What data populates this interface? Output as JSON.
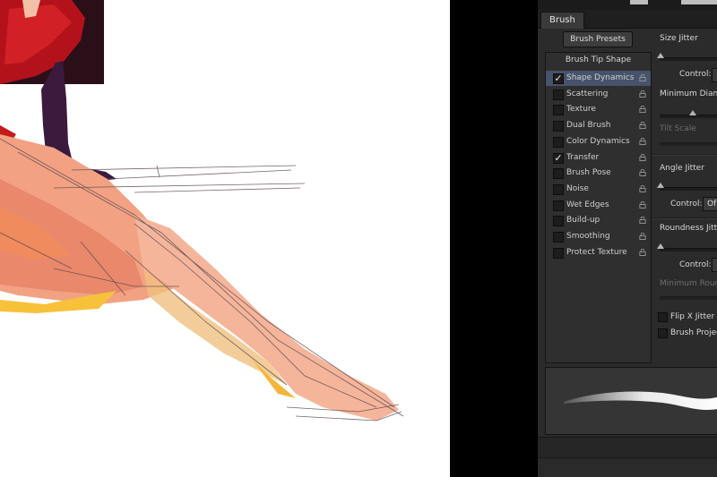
{
  "panel": {
    "tab_label": "Brush",
    "presets_button": "Brush Presets",
    "options_header": "Brush Tip Shape",
    "options": [
      {
        "label": "Shape Dynamics",
        "checked": true,
        "selected": true
      },
      {
        "label": "Scattering",
        "checked": false,
        "selected": false
      },
      {
        "label": "Texture",
        "checked": false,
        "selected": false
      },
      {
        "label": "Dual Brush",
        "checked": false,
        "selected": false
      },
      {
        "label": "Color Dynamics",
        "checked": false,
        "selected": false
      },
      {
        "label": "Transfer",
        "checked": true,
        "selected": false
      },
      {
        "label": "Brush Pose",
        "checked": false,
        "selected": false
      },
      {
        "label": "Noise",
        "checked": false,
        "selected": false
      },
      {
        "label": "Wet Edges",
        "checked": false,
        "selected": false
      },
      {
        "label": "Build-up",
        "checked": false,
        "selected": false
      },
      {
        "label": "Smoothing",
        "checked": false,
        "selected": false
      },
      {
        "label": "Protect Texture",
        "checked": false,
        "selected": false
      }
    ],
    "settings": {
      "size_jitter": "Size Jitter",
      "control_label_1": "Control:",
      "minimum_diameter": "Minimum Diamet",
      "tilt_scale": "Tilt Scale",
      "angle_jitter": "Angle Jitter",
      "control_label_2": "Control:",
      "angle_control_value": "Of",
      "roundness_jitter": "Roundness Jitter",
      "control_label_3": "Control:",
      "minimum_roundness": "Minimum Round",
      "flip_x_jitter": "Flip X Jitter",
      "brush_projection": "Brush Projec"
    }
  },
  "colors": {
    "panel_bg": "#2b2b2b",
    "selection": "#47536b",
    "canvas": "#ffffff"
  },
  "icons": {
    "check": "✓",
    "lock": "lock-icon"
  }
}
